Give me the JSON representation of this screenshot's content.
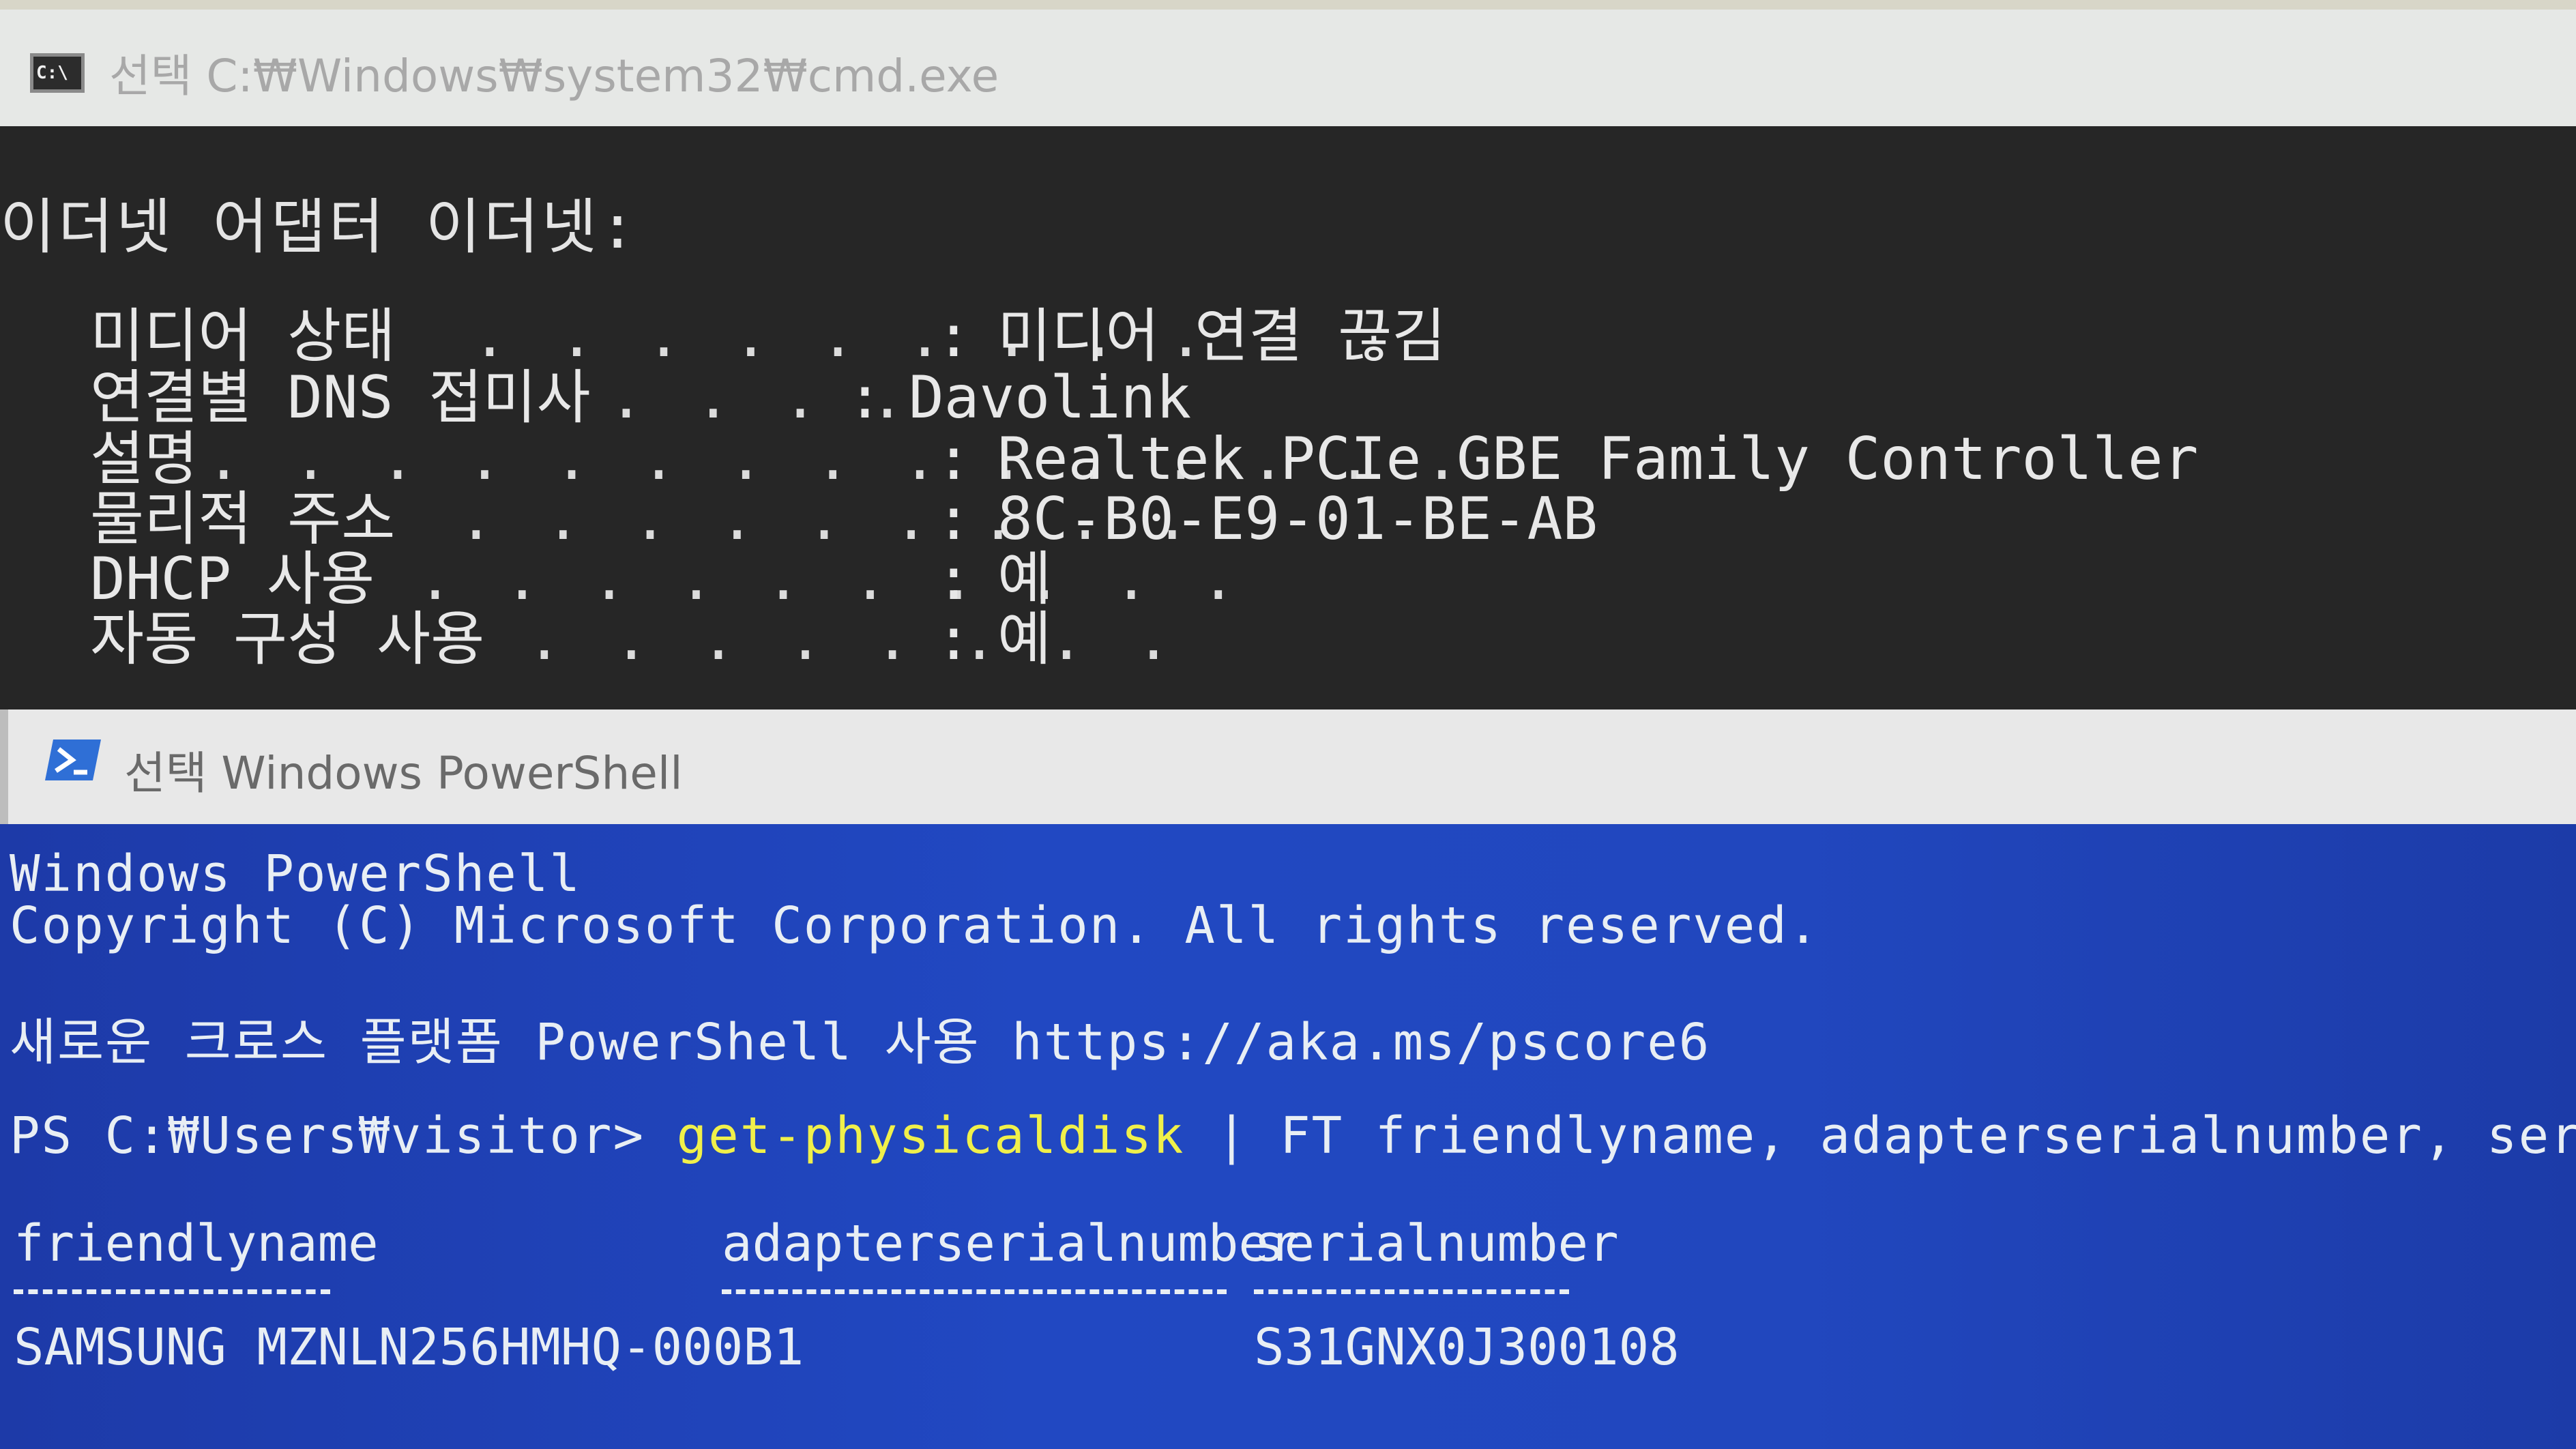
{
  "cmd_window": {
    "title": "선택 C:₩Windows₩system32₩cmd.exe",
    "icon_text": "C:\\",
    "heading": "이더넷 어댑터 이더넷:",
    "rows": [
      {
        "label": "미디어 상태",
        "dots": ". . . . . . . . .",
        "colon": ":",
        "value": "미디어 연결 끊김"
      },
      {
        "label": "연결별 DNS 접미사",
        "dots": ". . . .",
        "colon": ":",
        "value": "Davolink"
      },
      {
        "label": "설명",
        "dots": ". . . . . . . . . . . . . . .",
        "colon": ":",
        "value": "Realtek PCIe GBE Family Controller"
      },
      {
        "label": "물리적 주소",
        "dots": ". . . . . . . . .",
        "colon": ":",
        "value": "8C-B0-E9-01-BE-AB"
      },
      {
        "label": "DHCP 사용",
        "dots": ". . . . . . . . . .",
        "colon": ":",
        "value": "예"
      },
      {
        "label": "자동 구성 사용",
        "dots": ". . . . . . . .",
        "colon": ":",
        "value": "예"
      }
    ]
  },
  "ps_window": {
    "title": "선택 Windows PowerShell",
    "banner_line1": "Windows PowerShell",
    "banner_line2": "Copyright (C) Microsoft Corporation. All rights reserved.",
    "promo_line": "새로운 크로스 플랫폼 PowerShell 사용 https://aka.ms/pscore6",
    "prompt": "PS C:₩Users₩visitor> ",
    "command_cmdlet": "get-physicaldisk",
    "command_rest": " | FT friendlyname, adapterserialnumber, serialnumber",
    "table": {
      "headers": [
        "friendlyname",
        "adapterserialnumber",
        "serialnumber"
      ],
      "rows": [
        [
          "SAMSUNG MZNLN256HMHQ-000B1",
          "",
          "S31GNX0J300108"
        ]
      ]
    }
  },
  "colors": {
    "cmd_background": "#262626",
    "ps_background": "#2148c2",
    "cmdlet_highlight": "#f0f04a",
    "titlebar": "#e6e8e6"
  }
}
